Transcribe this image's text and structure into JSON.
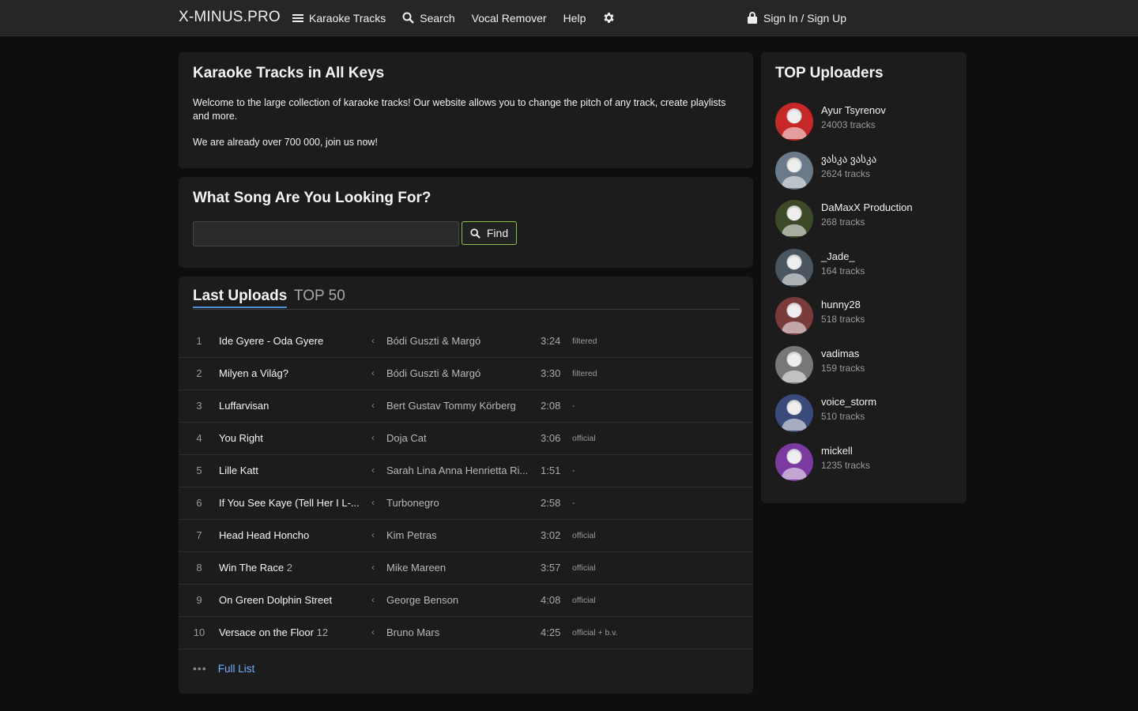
{
  "header": {
    "logo": "X-MINUS.PRO",
    "nav": [
      {
        "label": "Karaoke Tracks",
        "icon": "menu-icon"
      },
      {
        "label": "Search",
        "icon": "search-icon"
      },
      {
        "label": "Vocal Remover"
      },
      {
        "label": "Help"
      }
    ],
    "signin": "Sign In / Sign Up"
  },
  "welcome": {
    "title": "Karaoke Tracks in All Keys",
    "text1": "Welcome to the large collection of karaoke tracks! Our website allows you to change the pitch of any track, create playlists and more.",
    "text2": "We are already over 700 000, join us now!"
  },
  "search": {
    "title": "What Song Are You Looking For?",
    "input_value": "",
    "button": "Find"
  },
  "uploads": {
    "tabs": [
      "Last Uploads",
      "TOP 50"
    ],
    "rows": [
      {
        "num": "1",
        "title": "Ide Gyere - Oda Gyere",
        "extra": "",
        "artist": "Bódi Guszti & Margó",
        "dur": "3:24",
        "tag": "filtered"
      },
      {
        "num": "2",
        "title": "Milyen a Világ?",
        "extra": "",
        "artist": "Bódi Guszti & Margó",
        "dur": "3:30",
        "tag": "filtered"
      },
      {
        "num": "3",
        "title": "Luffarvisan",
        "extra": "",
        "artist": "Bert Gustav Tommy Körberg",
        "dur": "2:08",
        "tag": "-"
      },
      {
        "num": "4",
        "title": "You Right",
        "extra": "",
        "artist": "Doja Cat",
        "dur": "3:06",
        "tag": "official"
      },
      {
        "num": "5",
        "title": "Lille Katt",
        "extra": "",
        "artist": "Sarah Lina Anna Henrietta Ri...",
        "dur": "1:51",
        "tag": "-"
      },
      {
        "num": "6",
        "title": "If You See Kaye (Tell Her I L-...",
        "extra": "",
        "artist": "Turbonegro",
        "dur": "2:58",
        "tag": "-"
      },
      {
        "num": "7",
        "title": "Head Head Honcho",
        "extra": "",
        "artist": "Kim Petras",
        "dur": "3:02",
        "tag": "official"
      },
      {
        "num": "8",
        "title": "Win The Race",
        "extra": "2",
        "artist": "Mike Mareen",
        "dur": "3:57",
        "tag": "official"
      },
      {
        "num": "9",
        "title": "On Green Dolphin Street",
        "extra": "",
        "artist": "George Benson",
        "dur": "4:08",
        "tag": "official"
      },
      {
        "num": "10",
        "title": "Versace on the Floor",
        "extra": "12",
        "artist": "Bruno Mars",
        "dur": "4:25",
        "tag": "official + b.v."
      }
    ],
    "full_list": "Full List"
  },
  "top_uploaders": {
    "title": "TOP Uploaders",
    "items": [
      {
        "name": "Ayur Tsyrenov",
        "count": "24003 tracks",
        "color": "#c62828"
      },
      {
        "name": "ვასკა ვასკა",
        "count": "2624 tracks",
        "color": "#6b7a88"
      },
      {
        "name": "DaMaxX Production",
        "count": "268 tracks",
        "color": "#3d4a2a"
      },
      {
        "name": "_Jade_",
        "count": "164 tracks",
        "color": "#4a5560"
      },
      {
        "name": "hunny28",
        "count": "518 tracks",
        "color": "#7a3b3b"
      },
      {
        "name": "vadimas",
        "count": "159 tracks",
        "color": "#777777"
      },
      {
        "name": "voice_storm",
        "count": "510 tracks",
        "color": "#3a4a7a"
      },
      {
        "name": "mickell",
        "count": "1235 tracks",
        "color": "#7a3aa0"
      }
    ]
  }
}
